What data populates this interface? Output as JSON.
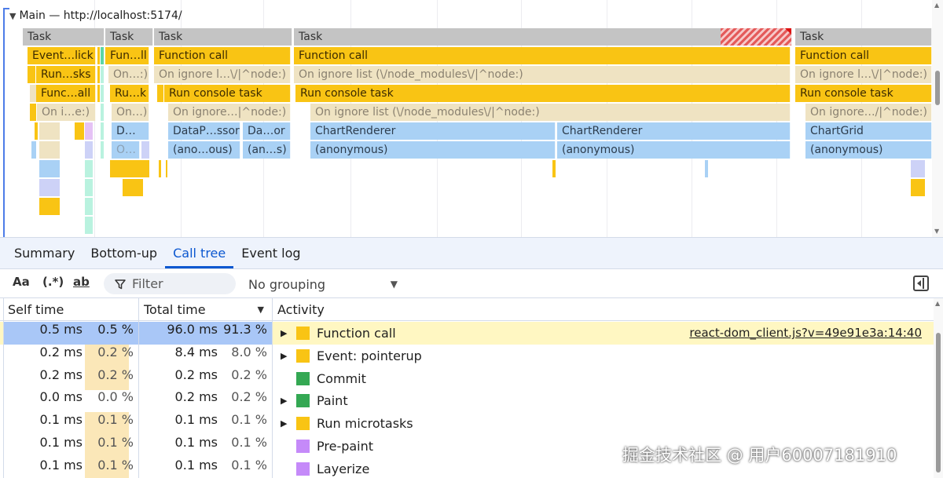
{
  "flame": {
    "track_title": "Main — http://localhost:5174/",
    "task_labels": [
      "Task",
      "Task",
      "Task",
      "Task",
      "Task"
    ],
    "row1": [
      "Event…lick",
      "Fun…ll",
      "Function call",
      "Function call",
      "Function call"
    ],
    "row2": [
      "Run…sks",
      "On…:)",
      "On ignore l…\\/|^node:)",
      "On ignore list (\\/node_modules\\/|^node:)",
      "On ignore l…\\/|^node:)"
    ],
    "row3": [
      "Func…all",
      "Ru…k",
      "Run console task",
      "Run console task",
      "Run console task"
    ],
    "row4": [
      "On i…e:)",
      "On…)",
      "On ignore…|^node:)",
      "On ignore list (\\/node_modules\\/|^node:)",
      "On ignore…/|^node:)"
    ],
    "row5": [
      "D…",
      "DataP…ssor",
      "Da…or",
      "ChartRenderer",
      "ChartRenderer",
      "ChartGrid"
    ],
    "row6": [
      "O…",
      "(ano…ous)",
      "(an…s)",
      "(anonymous)",
      "(anonymous)",
      "(anonymous)"
    ]
  },
  "tabs": [
    {
      "label": "Summary"
    },
    {
      "label": "Bottom-up"
    },
    {
      "label": "Call tree",
      "active": true
    },
    {
      "label": "Event log"
    }
  ],
  "toolbar": {
    "match_case": "Aa",
    "regex": "(.*)",
    "whole_word": "ab",
    "filter_placeholder": "Filter",
    "grouping_value": "No grouping"
  },
  "table": {
    "headers": {
      "self_time": "Self time",
      "total_time": "Total time",
      "activity": "Activity"
    },
    "rows": [
      {
        "self_ms": "0.5 ms",
        "self_pct": "0.5 %",
        "total_ms": "96.0 ms",
        "total_pct": "91.3 %",
        "activity": "Function call",
        "color": "#f9c414",
        "expandable": true,
        "source": "react-dom_client.js?v=49e91e3a:14:40",
        "selected": true,
        "self_frac": 0.005,
        "total_frac": 0.913
      },
      {
        "self_ms": "0.2 ms",
        "self_pct": "0.2 %",
        "total_ms": "8.4 ms",
        "total_pct": "8.0 %",
        "activity": "Event: pointerup",
        "color": "#f9c414",
        "expandable": true,
        "self_frac": 0.002,
        "total_frac": 0.08
      },
      {
        "self_ms": "0.2 ms",
        "self_pct": "0.2 %",
        "total_ms": "0.2 ms",
        "total_pct": "0.2 %",
        "activity": "Commit",
        "color": "#34a853",
        "expandable": false,
        "self_frac": 0.002,
        "total_frac": 0.002
      },
      {
        "self_ms": "0.0 ms",
        "self_pct": "0.0 %",
        "total_ms": "0.2 ms",
        "total_pct": "0.2 %",
        "activity": "Paint",
        "color": "#34a853",
        "expandable": true,
        "self_frac": 0.0,
        "total_frac": 0.002
      },
      {
        "self_ms": "0.1 ms",
        "self_pct": "0.1 %",
        "total_ms": "0.1 ms",
        "total_pct": "0.1 %",
        "activity": "Run microtasks",
        "color": "#f9c414",
        "expandable": true,
        "self_frac": 0.001,
        "total_frac": 0.001
      },
      {
        "self_ms": "0.1 ms",
        "self_pct": "0.1 %",
        "total_ms": "0.1 ms",
        "total_pct": "0.1 %",
        "activity": "Pre-paint",
        "color": "#c58af9",
        "expandable": false,
        "self_frac": 0.001,
        "total_frac": 0.001
      },
      {
        "self_ms": "0.1 ms",
        "self_pct": "0.1 %",
        "total_ms": "0.1 ms",
        "total_pct": "0.1 %",
        "activity": "Layerize",
        "color": "#c58af9",
        "expandable": false,
        "self_frac": 0.001,
        "total_frac": 0.001
      }
    ]
  },
  "watermark": "掘金技术社区 @ 用户60007181910"
}
